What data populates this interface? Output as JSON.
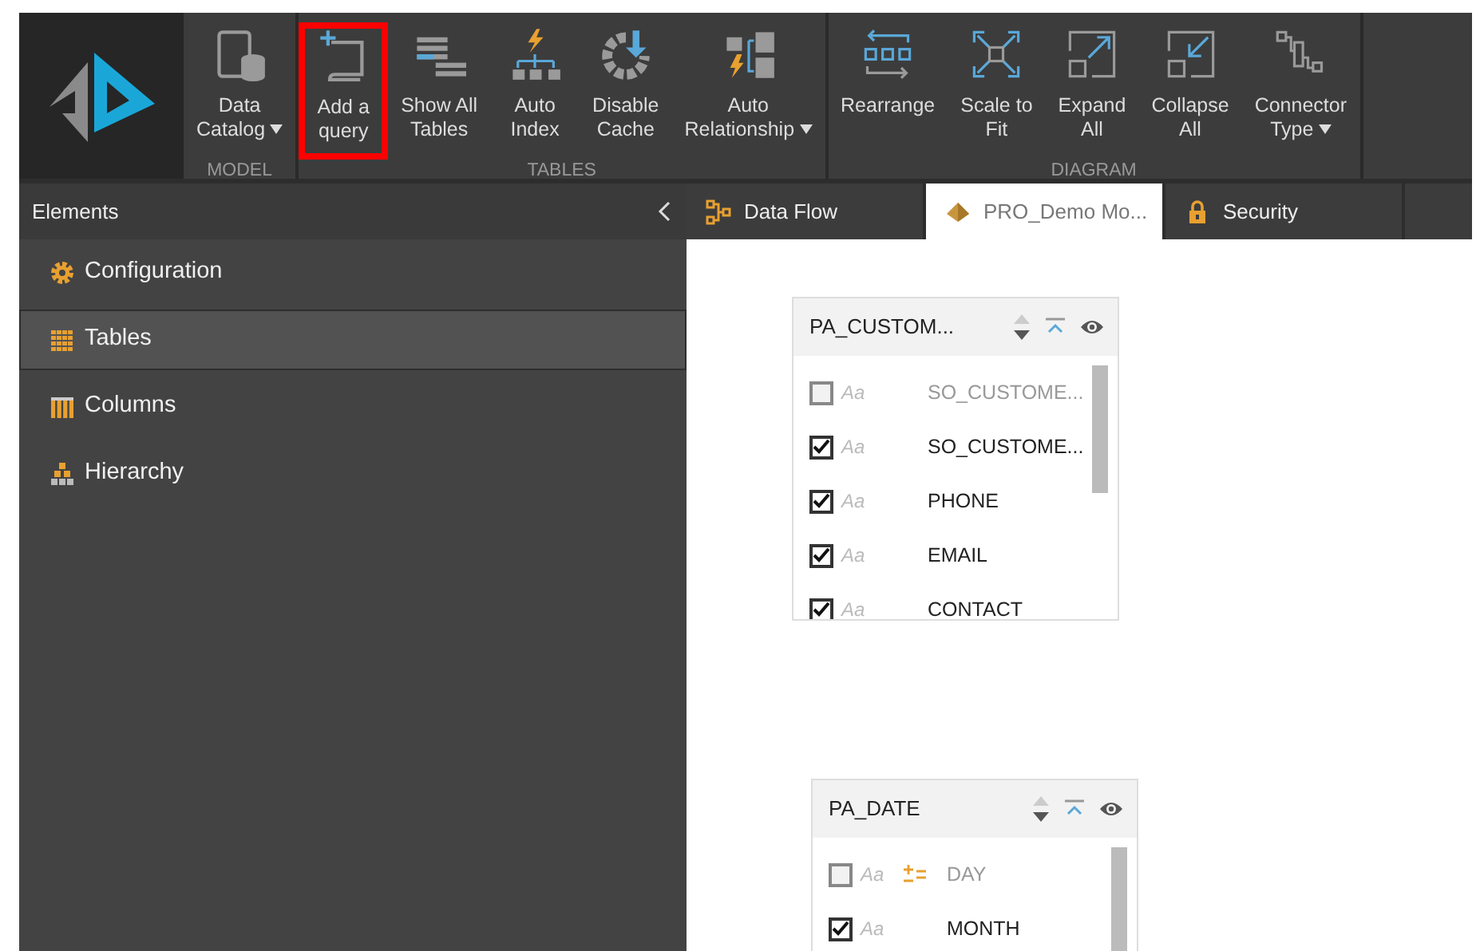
{
  "ribbon": {
    "groups": [
      {
        "label": "MODEL",
        "buttons": [
          {
            "label_lines": [
              "Data",
              "Catalog"
            ],
            "dropdown": true,
            "highlighted": false
          }
        ]
      },
      {
        "label": "TABLES",
        "buttons": [
          {
            "label_lines": [
              "Add a",
              "query"
            ],
            "dropdown": false,
            "highlighted": true
          },
          {
            "label_lines": [
              "Show All",
              "Tables"
            ],
            "dropdown": false,
            "highlighted": false
          },
          {
            "label_lines": [
              "Auto",
              "Index"
            ],
            "dropdown": false,
            "highlighted": false
          },
          {
            "label_lines": [
              "Disable",
              "Cache"
            ],
            "dropdown": false,
            "highlighted": false
          },
          {
            "label_lines": [
              "Auto",
              "Relationship"
            ],
            "dropdown": true,
            "highlighted": false
          }
        ]
      },
      {
        "label": "DIAGRAM",
        "buttons": [
          {
            "label_lines": [
              "Rearrange"
            ],
            "dropdown": false,
            "highlighted": false
          },
          {
            "label_lines": [
              "Scale to",
              "Fit"
            ],
            "dropdown": false,
            "highlighted": false
          },
          {
            "label_lines": [
              "Expand",
              "All"
            ],
            "dropdown": false,
            "highlighted": false
          },
          {
            "label_lines": [
              "Collapse",
              "All"
            ],
            "dropdown": false,
            "highlighted": false
          },
          {
            "label_lines": [
              "Connector",
              "Type"
            ],
            "dropdown": true,
            "highlighted": false
          }
        ]
      }
    ]
  },
  "sidebar": {
    "title": "Elements",
    "items": [
      {
        "label": "Configuration",
        "selected": false
      },
      {
        "label": "Tables",
        "selected": true
      },
      {
        "label": "Columns",
        "selected": false
      },
      {
        "label": "Hierarchy",
        "selected": false
      }
    ]
  },
  "tabs": [
    {
      "label": "Data Flow",
      "selected": false
    },
    {
      "label": "PRO_Demo Mo...",
      "selected": true
    },
    {
      "label": "Security",
      "selected": false
    }
  ],
  "canvas": {
    "tables": [
      {
        "title": "PA_CUSTOM...",
        "fields": [
          {
            "type_label": "Aa",
            "name": "SO_CUSTOME...",
            "checked": false,
            "key": false
          },
          {
            "type_label": "Aa",
            "name": "SO_CUSTOME...",
            "checked": true,
            "key": false
          },
          {
            "type_label": "Aa",
            "name": "PHONE",
            "checked": true,
            "key": false
          },
          {
            "type_label": "Aa",
            "name": "EMAIL",
            "checked": true,
            "key": false
          },
          {
            "type_label": "Aa",
            "name": "CONTACT",
            "checked": true,
            "key": false
          }
        ]
      },
      {
        "title": "PA_DATE",
        "fields": [
          {
            "type_label": "Aa",
            "name": "DAY",
            "checked": false,
            "key": true
          },
          {
            "type_label": "Aa",
            "name": "MONTH",
            "checked": true,
            "key": false
          }
        ]
      }
    ]
  }
}
